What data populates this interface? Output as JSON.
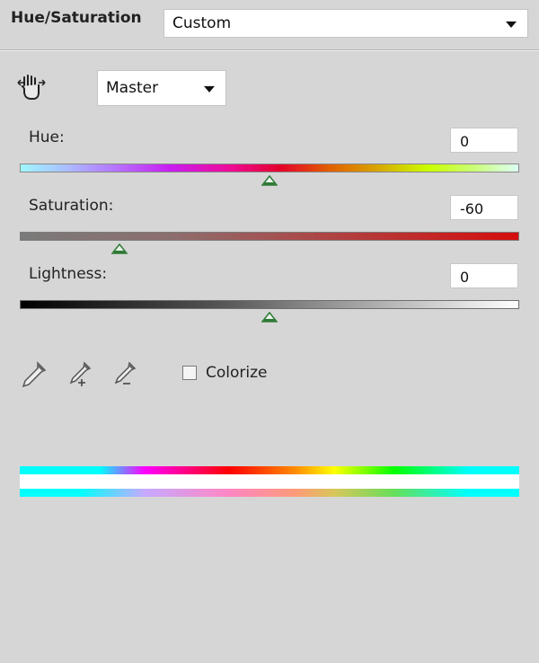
{
  "panel": {
    "title": "Hue/Saturation",
    "preset": {
      "value": "Custom"
    },
    "channel": {
      "value": "Master"
    }
  },
  "icons": {
    "targeted_adjustment": "hand-scrub-icon",
    "eyedropper": "eyedropper-icon",
    "eyedropper_add": "eyedropper-plus-icon",
    "eyedropper_subtract": "eyedropper-minus-icon",
    "dropdown": "chevron-down-icon"
  },
  "adjustments": {
    "hue": {
      "label": "Hue:",
      "value": "0",
      "slider_fraction": 0.5
    },
    "saturation": {
      "label": "Saturation:",
      "value": "-60",
      "slider_fraction": 0.2
    },
    "lightness": {
      "label": "Lightness:",
      "value": "0",
      "slider_fraction": 0.5
    }
  },
  "colorize": {
    "label": "Colorize",
    "checked": false
  },
  "colors": {
    "background": "#d6d6d6",
    "thumb": "#2f7a36"
  }
}
